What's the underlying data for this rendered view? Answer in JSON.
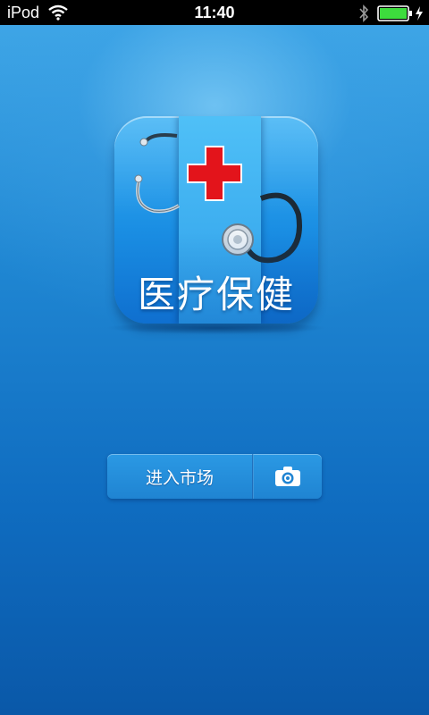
{
  "status_bar": {
    "carrier": "iPod",
    "time": "11:40",
    "battery_color": "#3ddc3d"
  },
  "app_icon": {
    "title": "医疗保健",
    "icon": "stethoscope-red-cross-icon"
  },
  "actions": {
    "enter_label": "进入市场",
    "camera_icon": "camera-icon"
  },
  "colors": {
    "background_top": "#3ea6e6",
    "background_bottom": "#0a58a8",
    "cross_red": "#e3141b"
  }
}
